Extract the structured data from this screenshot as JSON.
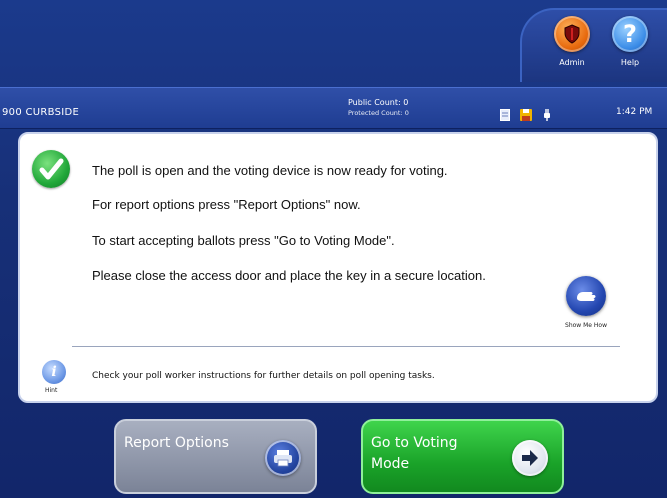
{
  "header": {
    "admin_label": "Admin",
    "help_label": "Help",
    "accent_admin": "#e86a0e",
    "accent_help": "#3d8ee8"
  },
  "status": {
    "precinct": "900 CURBSIDE",
    "public_count": "Public Count: 0",
    "protected_count": "Protected Count: 0",
    "time": "1:42 PM",
    "icons": [
      "document-icon",
      "floppy-disk-icon",
      "power-plug-icon"
    ]
  },
  "message": {
    "line1": "The poll is open and the voting device is now ready for voting.",
    "line2": "For report options press \"Report Options\" now.",
    "line3": "To start accepting ballots press \"Go to Voting Mode\".",
    "line4": "Please close the access door and place the key in a secure location.",
    "show_me_label": "Show Me How",
    "hint_label": "Hint",
    "hint_text": "Check your poll worker instructions for further details on poll opening tasks."
  },
  "buttons": {
    "report_options": "Report Options",
    "voting_mode": "Go to Voting Mode"
  }
}
